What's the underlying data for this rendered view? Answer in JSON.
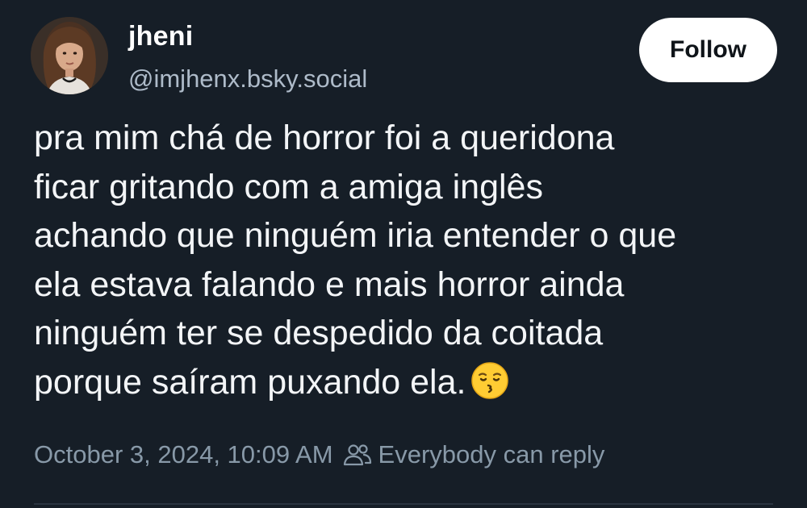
{
  "author": {
    "display_name": "jheni",
    "handle": "@imjhenx.bsky.social",
    "avatar_icon": "profile-photo"
  },
  "follow_button": {
    "label": "Follow"
  },
  "post": {
    "lines": [
      "pra mim chá de horror foi a queridona",
      "ficar gritando com a amiga inglês",
      "achando que ninguém iria entender o que",
      "ela estava falando e mais horror ainda",
      "ninguém ter se despedido da coitada",
      "porque saíram puxando ela."
    ],
    "emoji": "kissing-face-emoji"
  },
  "meta": {
    "timestamp": "October 3, 2024, 10:09 AM",
    "reply_icon": "people-icon",
    "reply_setting": "Everybody can reply"
  },
  "colors": {
    "background": "#161e27",
    "text": "#f3f5f7",
    "secondary_text": "#8899a8",
    "button_bg": "#ffffff"
  }
}
